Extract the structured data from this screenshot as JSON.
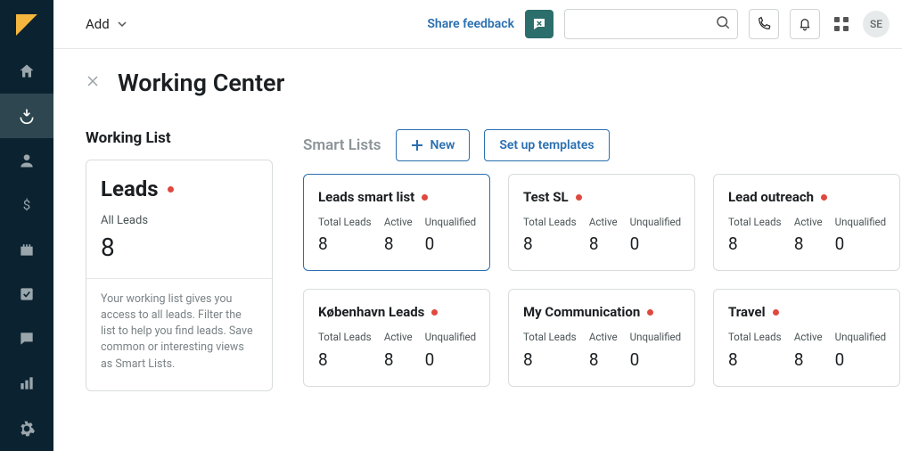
{
  "topbar": {
    "add_label": "Add",
    "feedback_label": "Share feedback",
    "search_placeholder": "",
    "avatar_initials": "SE"
  },
  "page": {
    "title": "Working Center"
  },
  "working_list": {
    "section_title": "Working List",
    "card_title": "Leads",
    "subtitle": "All Leads",
    "count": "8",
    "help_text": "Your working list gives you access to all leads. Filter the list to help you find leads. Save common or interesting views as Smart Lists."
  },
  "smart_lists": {
    "section_title": "Smart Lists",
    "new_button": "New",
    "templates_button": "Set up templates",
    "stat_labels": {
      "total": "Total Leads",
      "active": "Active",
      "unq": "Unqualified"
    },
    "cards": [
      {
        "name": "Leads smart list",
        "total": "8",
        "active": "8",
        "unq": "0",
        "featured": true
      },
      {
        "name": "Test SL",
        "total": "8",
        "active": "8",
        "unq": "0",
        "featured": false
      },
      {
        "name": "Lead outreach",
        "total": "8",
        "active": "8",
        "unq": "0",
        "featured": false
      },
      {
        "name": "København Leads",
        "total": "8",
        "active": "8",
        "unq": "0",
        "featured": false
      },
      {
        "name": "My Communication",
        "total": "8",
        "active": "8",
        "unq": "0",
        "featured": false
      },
      {
        "name": "Travel",
        "total": "8",
        "active": "8",
        "unq": "0",
        "featured": false
      }
    ]
  }
}
